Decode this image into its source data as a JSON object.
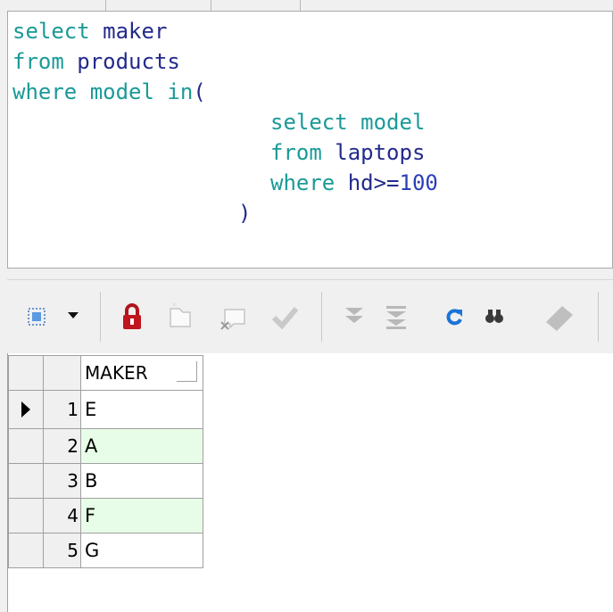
{
  "sql_editor": {
    "lines": [
      {
        "kw": "select",
        "rest": " maker"
      },
      {
        "kw": "from",
        "rest": " products"
      },
      {
        "kw": "where",
        "rest1": " model ",
        "kw2": "in",
        "rest2": "("
      },
      {
        "kw": "select",
        "rest": " model"
      },
      {
        "kw": "from",
        "rest": " laptops"
      },
      {
        "kw": "where",
        "rest": " hd>=",
        "num": "100"
      },
      {
        "rest": ")"
      }
    ]
  },
  "toolbar": {
    "icons": [
      "grid-select-icon",
      "dropdown-arrow-icon",
      "lock-icon",
      "new-record-icon",
      "delete-record-icon",
      "post-check-icon",
      "fetch-next-icon",
      "fetch-all-icon",
      "refresh-icon",
      "find-icon",
      "eraser-icon"
    ]
  },
  "grid": {
    "column_header": "MAKER",
    "rows": [
      {
        "num": "1",
        "maker": "E",
        "current": true
      },
      {
        "num": "2",
        "maker": "A"
      },
      {
        "num": "3",
        "maker": "B"
      },
      {
        "num": "4",
        "maker": "F"
      },
      {
        "num": "5",
        "maker": "G"
      }
    ],
    "alt_row_color": "#e7fde7"
  }
}
